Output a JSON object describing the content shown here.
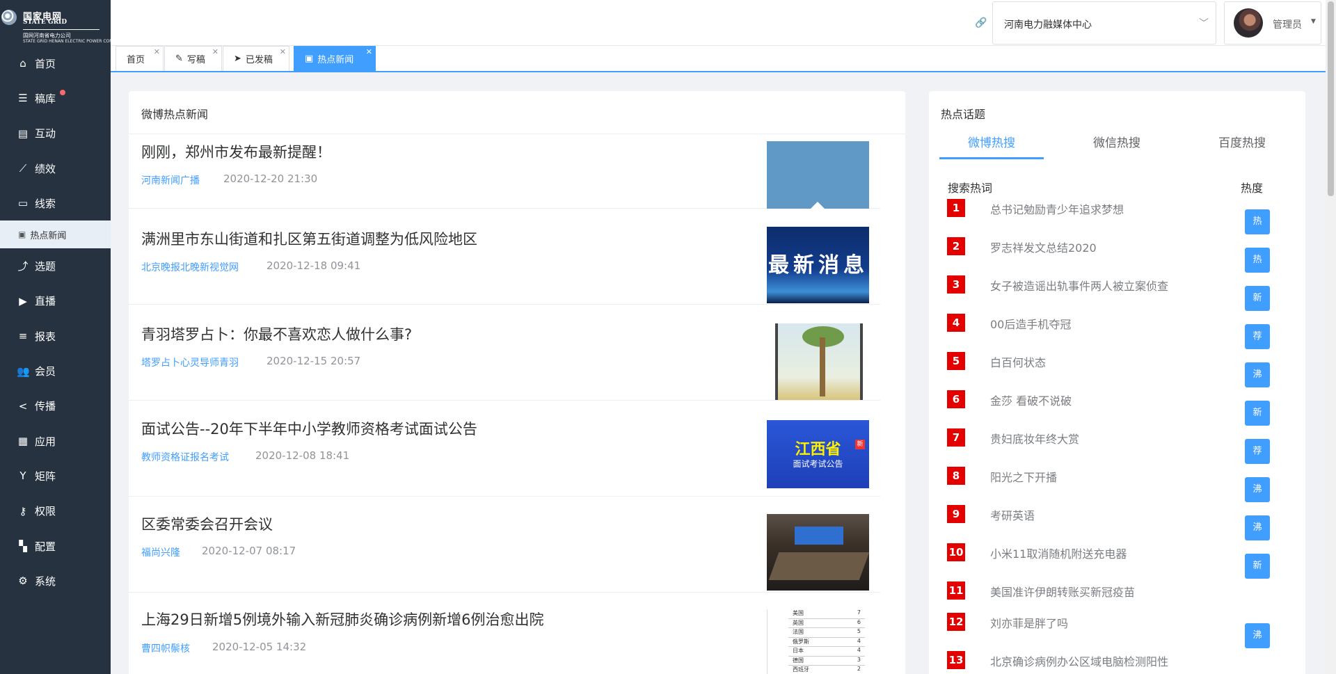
{
  "logo": {
    "cn": "国家电网",
    "en": "STATE GRID",
    "sub": "国网河南省电力公司",
    "sub_en": "STATE GRID HENAN ELECTRIC POWER COMPANY"
  },
  "sidebar": {
    "items": [
      {
        "label": "首页",
        "icon": "home-icon",
        "glyph": "⌂"
      },
      {
        "label": "稿库",
        "icon": "list-icon",
        "glyph": "☰"
      },
      {
        "label": "互动",
        "icon": "chat-icon",
        "glyph": "▤"
      },
      {
        "label": "绩效",
        "icon": "trend-icon",
        "glyph": "⟋"
      },
      {
        "label": "线索",
        "icon": "clue-icon",
        "glyph": "▭"
      },
      {
        "label": "热点新闻",
        "icon": "news-icon",
        "glyph": "▣"
      },
      {
        "label": "选题",
        "icon": "topic-icon",
        "glyph": "⤴"
      },
      {
        "label": "直播",
        "icon": "video-icon",
        "glyph": "▶"
      },
      {
        "label": "报表",
        "icon": "report-icon",
        "glyph": "≡"
      },
      {
        "label": "会员",
        "icon": "users-icon",
        "glyph": "👥"
      },
      {
        "label": "传播",
        "icon": "share-icon",
        "glyph": "<"
      },
      {
        "label": "应用",
        "icon": "app-icon",
        "glyph": "▦"
      },
      {
        "label": "矩阵",
        "icon": "matrix-icon",
        "glyph": "Y"
      },
      {
        "label": "权限",
        "icon": "key-icon",
        "glyph": "⚷"
      },
      {
        "label": "配置",
        "icon": "config-icon",
        "glyph": "▚"
      },
      {
        "label": "系统",
        "icon": "gear-icon",
        "glyph": "⚙"
      }
    ]
  },
  "header": {
    "site": "河南电力融媒体中心",
    "user": "管理员"
  },
  "tabs": [
    {
      "label": "首页"
    },
    {
      "label": "写稿"
    },
    {
      "label": "已发稿"
    },
    {
      "label": "热点新闻"
    }
  ],
  "news": {
    "title": "微博热点新闻",
    "items": [
      {
        "title": "刚刚，郑州市发布最新提醒！",
        "source": "河南新闻广播",
        "time": "2020-12-20 21:30"
      },
      {
        "title": "满洲里市东山街道和扎区第五街道调整为低风险地区",
        "source": "北京晚报北晚新视觉网",
        "time": "2020-12-18 09:41",
        "thumb_text": "最新消息"
      },
      {
        "title": "青羽塔罗占卜：你最不喜欢恋人做什么事?",
        "source": "塔罗占卜心灵导师青羽",
        "time": "2020-12-15 20:57"
      },
      {
        "title": "面试公告--20年下半年中小学教师资格考试面试公告",
        "source": "教师资格证报名考试",
        "time": "2020-12-08 18:41",
        "thumb_l1": "江西省",
        "thumb_l2": "面试考试公告",
        "thumb_badge": "新"
      },
      {
        "title": "区委常委会召开会议",
        "source": "福尚兴隆",
        "time": "2020-12-07 08:17"
      },
      {
        "title": "上海29日新增5例境外输入新冠肺炎确诊病例新增6例治愈出院",
        "source": "曹四帜鬃核",
        "time": "2020-12-05 14:32"
      }
    ],
    "table_rows": [
      {
        "name": "美国",
        "num": "7"
      },
      {
        "name": "英国",
        "num": "6"
      },
      {
        "name": "法国",
        "num": "5"
      },
      {
        "name": "俄罗斯",
        "num": "4"
      },
      {
        "name": "日本",
        "num": "4"
      },
      {
        "name": "德国",
        "num": "3"
      },
      {
        "name": "西班牙",
        "num": "2"
      }
    ]
  },
  "hot": {
    "title": "热点话题",
    "tabs": [
      "微博热搜",
      "微信热搜",
      "百度热搜"
    ],
    "col_keyword": "搜索热词",
    "col_heat": "热度",
    "items": [
      {
        "rank": "1",
        "keyword": "总书记勉励青少年追求梦想",
        "tag": "热"
      },
      {
        "rank": "2",
        "keyword": "罗志祥发文总结2020",
        "tag": "热"
      },
      {
        "rank": "3",
        "keyword": "女子被造谣出轨事件两人被立案侦查",
        "tag": "新"
      },
      {
        "rank": "4",
        "keyword": "00后造手机夺冠",
        "tag": "荐"
      },
      {
        "rank": "5",
        "keyword": "白百何状态",
        "tag": "沸"
      },
      {
        "rank": "6",
        "keyword": "金莎 看破不说破",
        "tag": "新"
      },
      {
        "rank": "7",
        "keyword": "贵妇底妆年终大赏",
        "tag": "荐"
      },
      {
        "rank": "8",
        "keyword": "阳光之下开播",
        "tag": "沸"
      },
      {
        "rank": "9",
        "keyword": "考研英语",
        "tag": "沸"
      },
      {
        "rank": "10",
        "keyword": "小米11取消随机附送充电器",
        "tag": "新"
      },
      {
        "rank": "11",
        "keyword": "美国准许伊朗转账买新冠疫苗",
        "tag": ""
      },
      {
        "rank": "12",
        "keyword": "刘亦菲是胖了吗",
        "tag": "沸"
      },
      {
        "rank": "13",
        "keyword": "北京确诊病例办公区域电脑检测阳性",
        "tag": ""
      }
    ]
  },
  "colors": {
    "sidebar_bg": "#273241",
    "accent": "#409eff",
    "rank_red": "#e50000"
  }
}
